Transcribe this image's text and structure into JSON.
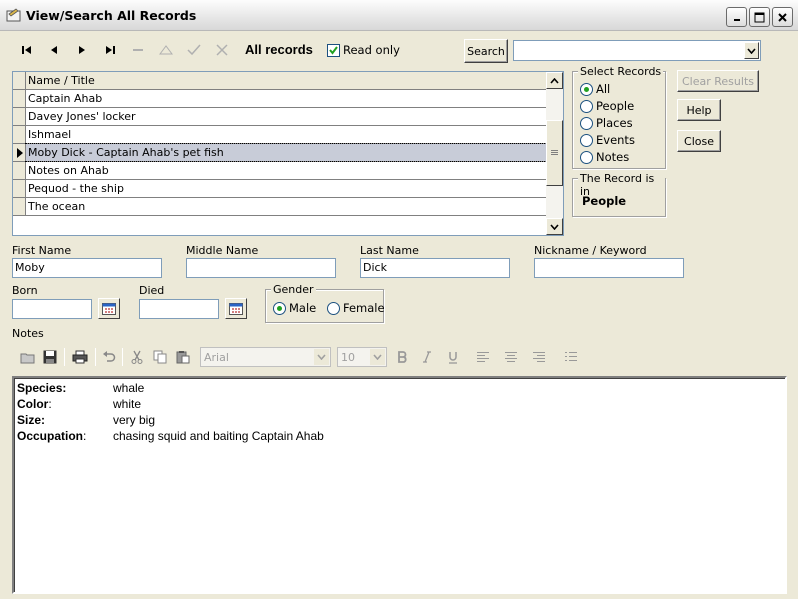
{
  "window": {
    "title": "View/Search All Records"
  },
  "toolbar": {
    "all_records_label": "All records",
    "read_only_label": "Read only",
    "read_only_checked": true,
    "search_label": "Search",
    "search_value": ""
  },
  "grid": {
    "header": "Name / Title",
    "rows": [
      "Captain Ahab",
      "Davey Jones' locker",
      "Ishmael",
      "Moby Dick - Captain Ahab's pet fish",
      "Notes on Ahab",
      "Pequod - the ship",
      "The ocean"
    ],
    "selected_row": 3
  },
  "select_records": {
    "legend": "Select Records",
    "options": [
      "All",
      "People",
      "Places",
      "Events",
      "Notes"
    ],
    "selected": "All"
  },
  "record_is_in": {
    "legend": "The Record is in",
    "value": "People"
  },
  "buttons": {
    "clear_results": "Clear Results",
    "help": "Help",
    "close": "Close"
  },
  "fields": {
    "first_name": {
      "label": "First Name",
      "value": "Moby"
    },
    "middle_name": {
      "label": "Middle Name",
      "value": ""
    },
    "last_name": {
      "label": "Last Name",
      "value": "Dick"
    },
    "nickname": {
      "label": "Nickname / Keyword",
      "value": ""
    },
    "born": {
      "label": "Born",
      "value": ""
    },
    "died": {
      "label": "Died",
      "value": ""
    }
  },
  "gender": {
    "legend": "Gender",
    "options": [
      "Male",
      "Female"
    ],
    "selected": "Male"
  },
  "notes": {
    "label": "Notes",
    "font_name": "Arial",
    "font_size": "10",
    "lines": [
      {
        "key": "Species:",
        "key_bold": true,
        "value": "whale"
      },
      {
        "key": "Color",
        "key_suffix": ":",
        "key_bold": true,
        "value": "white"
      },
      {
        "key": "Size:",
        "key_bold": true,
        "value": "very big"
      },
      {
        "key": "Occupation",
        "key_suffix": ":",
        "key_bold": true,
        "value": "chasing squid and baiting Captain Ahab"
      }
    ]
  },
  "colors": {
    "window_bg": "#ece9d8",
    "selected_row_bg": "#c8ccd8",
    "radio_dot": "#21a121",
    "field_border": "#7f9db9"
  }
}
